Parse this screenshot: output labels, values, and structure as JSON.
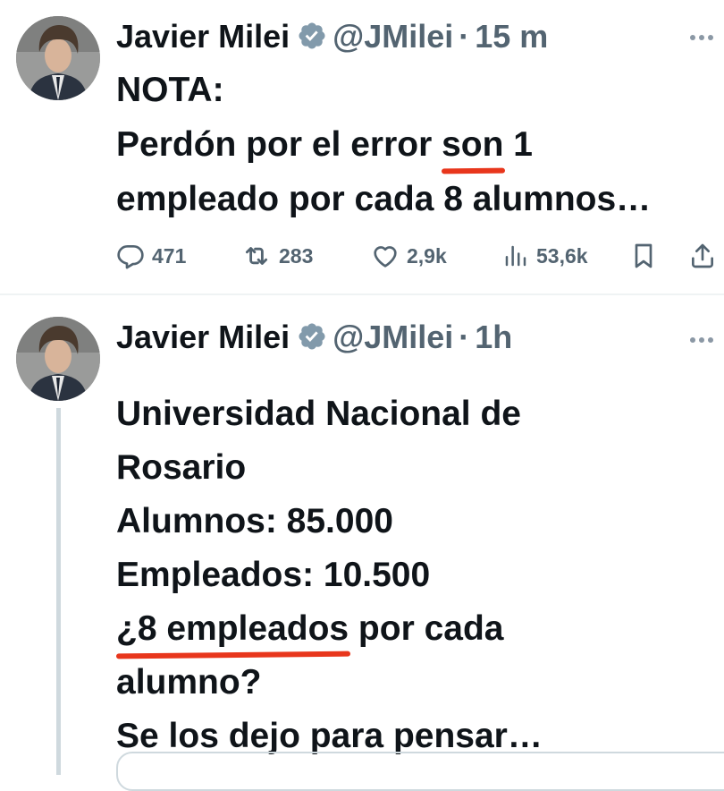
{
  "tweets": [
    {
      "author": {
        "name": "Javier Milei",
        "handle": "@JMilei"
      },
      "separator": "·",
      "time": "15 m",
      "text": {
        "line1": "NOTA:",
        "line2_before": "Perdón por el error ",
        "line2_highlight": "son",
        "line2_after": " 1",
        "line3": "empleado por cada 8 alumnos…"
      },
      "actions": {
        "replies": "471",
        "retweets": "283",
        "likes": "2,9k",
        "views": "53,6k"
      }
    },
    {
      "author": {
        "name": "Javier Milei",
        "handle": "@JMilei"
      },
      "separator": "·",
      "time": "1h",
      "text": {
        "line1": "Universidad Nacional de",
        "line2": "Rosario",
        "line3": "Alumnos: 85.000",
        "line4": "Empleados: 10.500",
        "line5_highlight": "¿8 empleados",
        "line5_after": " por cada",
        "line6": "alumno?",
        "line7": "Se los dejo para pensar…"
      }
    }
  ],
  "icons": {
    "verified": "verified-badge-icon",
    "more": "more-options-icon",
    "reply": "reply-icon",
    "retweet": "retweet-icon",
    "like": "heart-icon",
    "views": "views-icon",
    "bookmark": "bookmark-icon",
    "share": "share-icon"
  },
  "colors": {
    "text_primary": "#0f1419",
    "text_secondary": "#536471",
    "verified_badge": "#829aab",
    "highlight_underline": "#e8361c",
    "divider": "#eff3f4"
  }
}
